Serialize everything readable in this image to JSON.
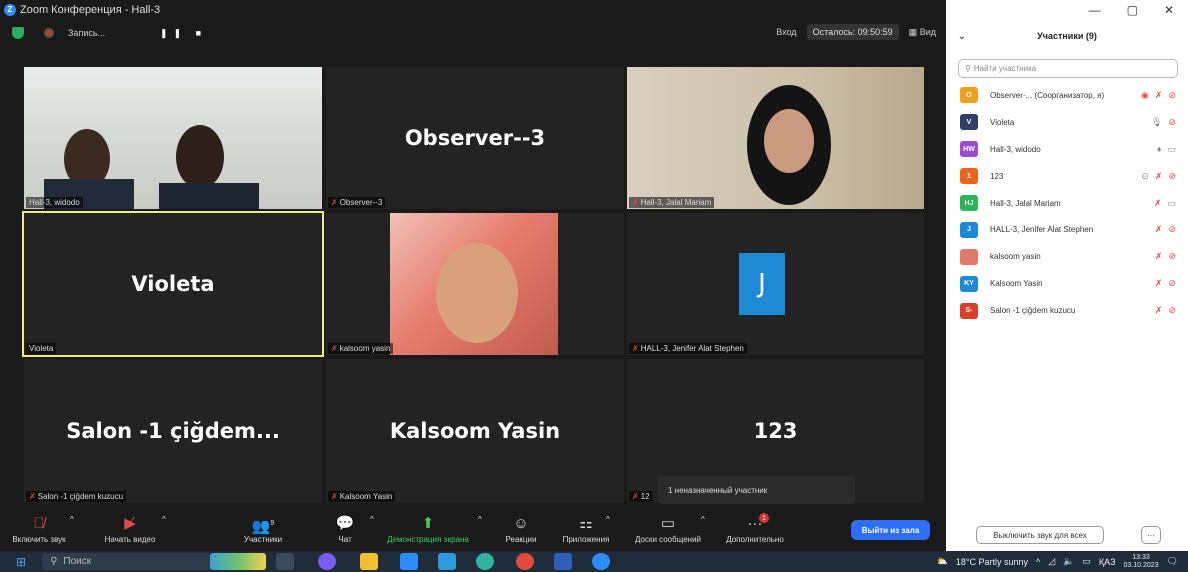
{
  "window": {
    "title": "Zoom Конференция - Hall-3",
    "minimize": "—",
    "maximize": "▢",
    "close": "✕"
  },
  "topbar": {
    "recording_label": "Запись...",
    "record_controls": "❚❚ ■",
    "enter": "Вход",
    "remaining": "Осталось: 09:50:59",
    "view": "Вид"
  },
  "tiles": [
    {
      "big": "",
      "name": "Hall-3, widodo"
    },
    {
      "big": "Observer--3",
      "name": "Observer--3"
    },
    {
      "big": "",
      "name": "Hall-3, Jalal Mariam"
    },
    {
      "big": "Violeta",
      "name": "Violeta"
    },
    {
      "big": "",
      "name": "kalsoom yasin"
    },
    {
      "big": "",
      "name": "HALL-3, Jenifer Alat Stephen",
      "initial": "J"
    },
    {
      "big": "Salon -1 çiğdem...",
      "name": "Salon -1 çiğdem kuzucu"
    },
    {
      "big": "Kalsoom Yasin",
      "name": "Kalsoom Yasin"
    },
    {
      "big": "123",
      "name": "12"
    }
  ],
  "tooltip": "1 неназначенный участник",
  "toolbar": {
    "unmute": "Включить звук",
    "start_video": "Начать видео",
    "participants": "Участники",
    "participants_count": "9",
    "chat": "Чат",
    "share": "Демонстрация экрана",
    "reactions": "Реакции",
    "apps": "Приложения",
    "whiteboards": "Доски сообщений",
    "more": "Дополнительно",
    "more_badge": "1",
    "leave": "Выйти из зала"
  },
  "panel": {
    "title": "Участники (9)",
    "search_placeholder": "Найти участника",
    "participants": [
      {
        "initials": "O",
        "name": "Observer-... (Соорганизатор, я)",
        "color": "#f0a020"
      },
      {
        "initials": "V",
        "name": "Violeta",
        "color": "#2c3e66"
      },
      {
        "initials": "HW",
        "name": "Hall-3, widodo",
        "color": "#9b4dca"
      },
      {
        "initials": "1",
        "name": "123",
        "color": "#e8661a"
      },
      {
        "initials": "HJ",
        "name": "Hall-3, Jalal Mariam",
        "color": "#2fb35a"
      },
      {
        "initials": "J",
        "name": "HALL-3, Jenifer Alat Stephen",
        "color": "#1e8ad6"
      },
      {
        "initials": "",
        "name": "kalsoom yasin",
        "color": "#e07a6a"
      },
      {
        "initials": "KY",
        "name": "Kalsoom Yasin",
        "color": "#1e8ad6"
      },
      {
        "initials": "S-",
        "name": "Salon -1 çiğdem kuzucu",
        "color": "#d9402b"
      }
    ],
    "mute_all": "Выключить звук для всех",
    "more": "···"
  },
  "taskbar": {
    "search": "Поиск",
    "weather": "18°C Partly sunny",
    "lang": "ҚАЗ",
    "time": "13:33",
    "date": "03.10.2023"
  }
}
